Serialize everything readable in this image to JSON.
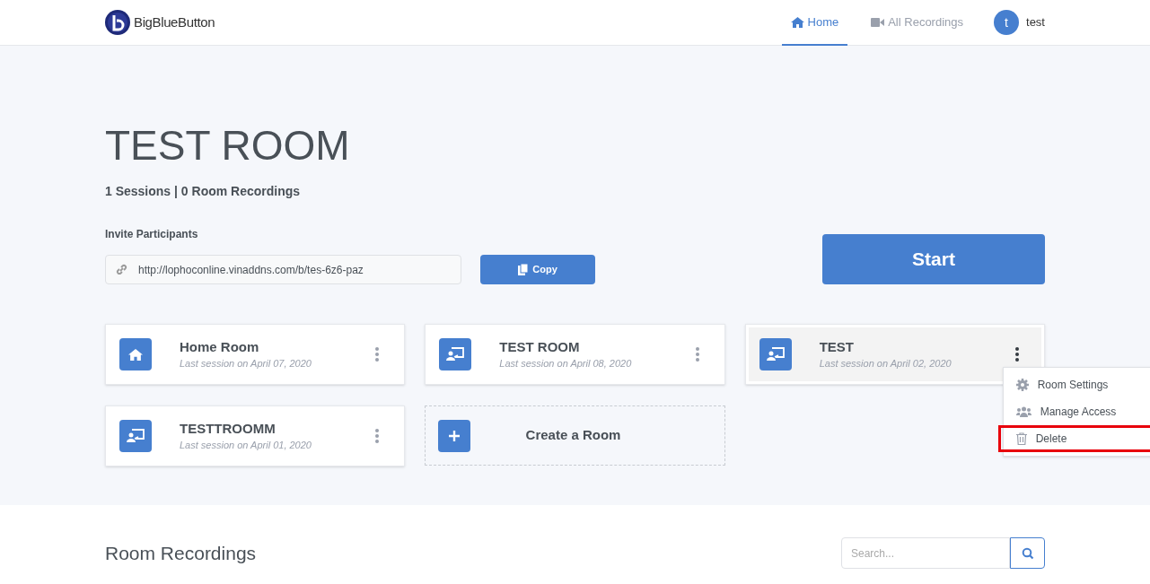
{
  "header": {
    "logo": "BigBlueButton",
    "nav": [
      {
        "label": "Home",
        "kind": "home",
        "selected": true
      },
      {
        "label": "All Recordings",
        "kind": "recordings",
        "selected": false
      }
    ],
    "user": {
      "initial": "t",
      "name": "test"
    }
  },
  "room": {
    "title": "TEST ROOM",
    "stats": "1 Sessions | 0 Room Recordings",
    "invite_label": "Invite Participants",
    "invite_url": "http://lophoconline.vinaddns.com/b/tes-6z6-paz",
    "copy_button": "Copy",
    "start_button": "Start"
  },
  "rooms": [
    {
      "kind": "home",
      "name": "Home Room",
      "last_session": "Last session on April 07, 2020",
      "menu_open": false
    },
    {
      "kind": "room",
      "name": "TEST ROOM",
      "last_session": "Last session on April 08, 2020",
      "menu_open": false
    },
    {
      "kind": "room",
      "name": "TEST",
      "last_session": "Last session on April 02, 2020",
      "menu_open": true
    },
    {
      "kind": "room",
      "name": "TESTTROOMM",
      "last_session": "Last session on April 01, 2020",
      "menu_open": false
    },
    {
      "kind": "create",
      "name": "Create a Room"
    }
  ],
  "room_menu": [
    {
      "kind": "settings",
      "label": "Room Settings",
      "highlighted": false
    },
    {
      "kind": "access",
      "label": "Manage Access",
      "highlighted": false
    },
    {
      "kind": "delete",
      "label": "Delete",
      "highlighted": true
    }
  ],
  "recordings": {
    "title": "Room Recordings",
    "search_placeholder": "Search..."
  }
}
